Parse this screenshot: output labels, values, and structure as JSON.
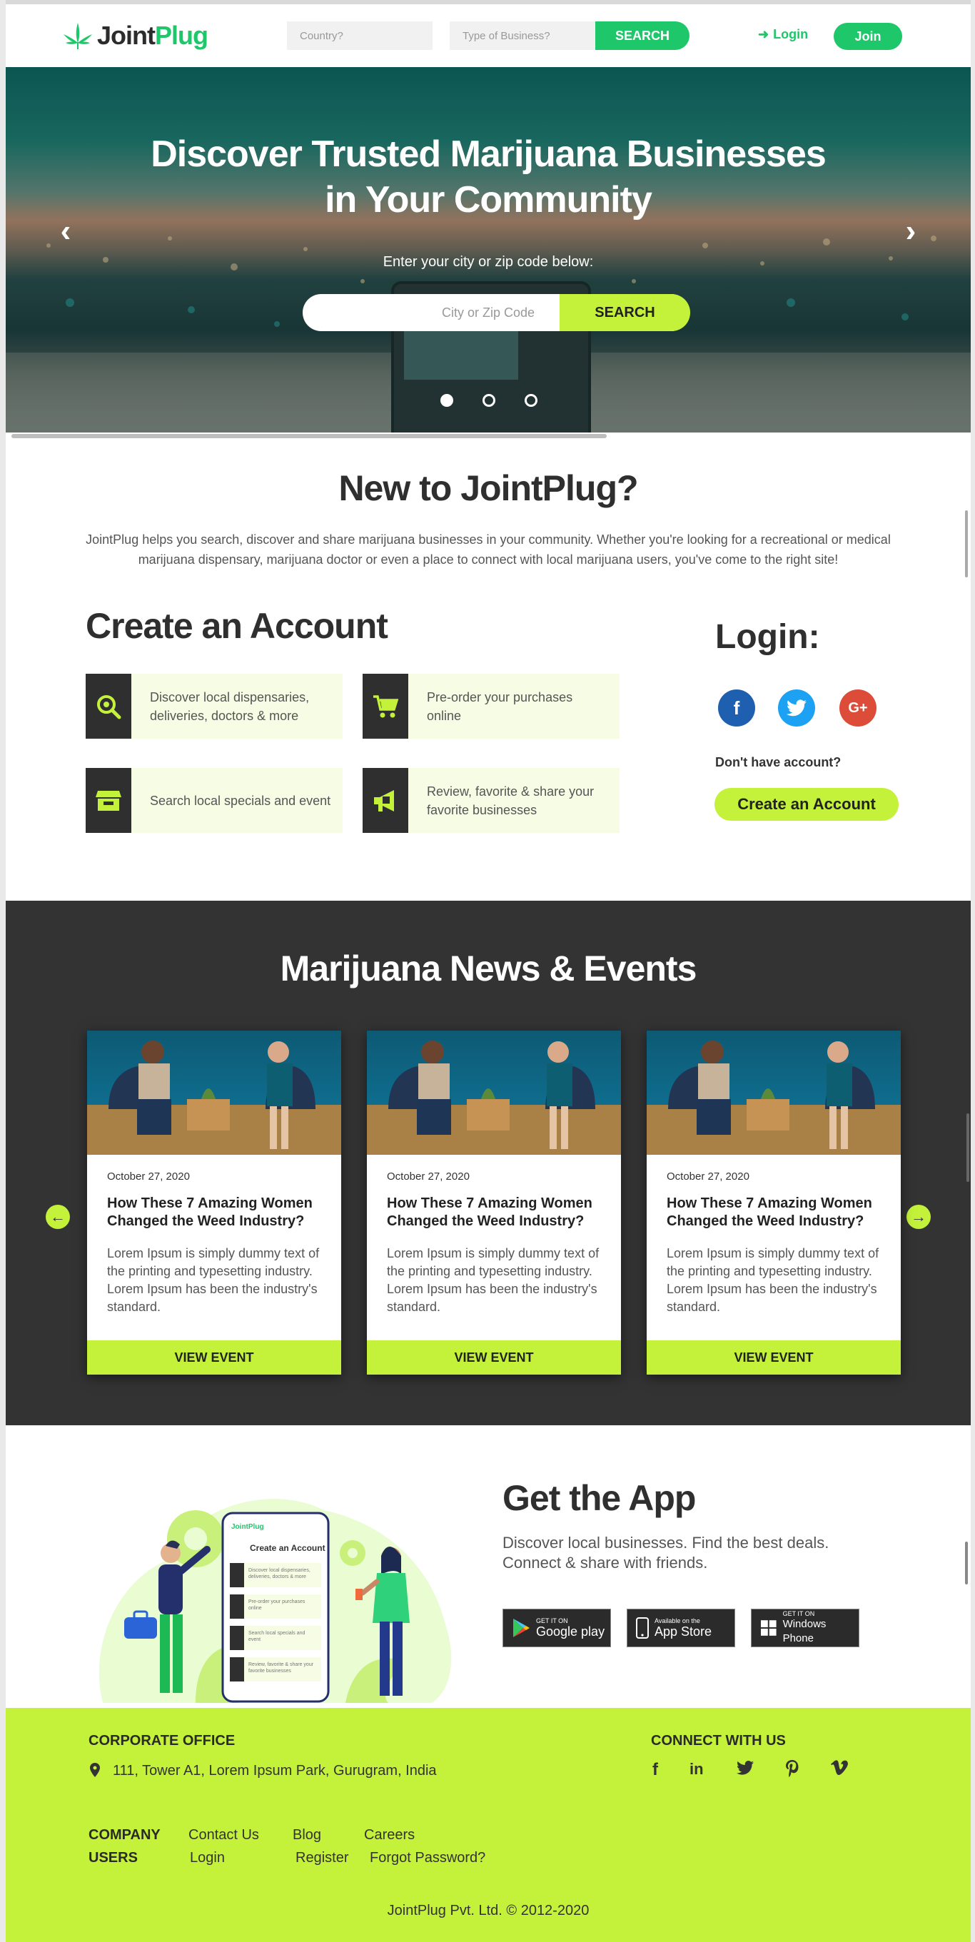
{
  "header": {
    "logo_j": "Joint",
    "logo_p": "Plug",
    "country_placeholder": "Country?",
    "business_placeholder": "Type of Business?",
    "search_label": "SEARCH",
    "login_label": "Login",
    "join_label": "Join"
  },
  "hero": {
    "title": "Discover Trusted Marijuana Businesses in Your Community",
    "subtitle": "Enter your city or zip code below:",
    "search_placeholder": "City or Zip Code",
    "search_label": "SEARCH",
    "slide_count": 3,
    "active_slide": 1
  },
  "intro": {
    "title": "New to JointPlug?",
    "text": "JointPlug helps you search, discover and share marijuana businesses in your community. Whether you're looking for a recreational or medical marijuana dispensary, marijuana doctor or even a place to connect with local marijuana users, you've come to the right site!"
  },
  "create_account": {
    "title": "Create an Account",
    "features": [
      {
        "icon": "search-leaf-icon",
        "text": "Discover local dispensaries, deliveries, doctors & more"
      },
      {
        "icon": "cart-icon",
        "text": "Pre-order your purchases online"
      },
      {
        "icon": "store-icon",
        "text": "Search local specials and event"
      },
      {
        "icon": "megaphone-icon",
        "text": "Review, favorite & share your favorite businesses"
      }
    ]
  },
  "login": {
    "title": "Login:",
    "no_account": "Don't have account?",
    "create_label": "Create an Account",
    "colors": {
      "facebook": "#1f5fb0",
      "twitter": "#1da1f2",
      "google": "#dd4b39"
    }
  },
  "news": {
    "title": "Marijuana News & Events",
    "cards": [
      {
        "date": "October 27, 2020",
        "title": "How These 7 Amazing Women Changed the Weed Industry?",
        "desc": "Lorem Ipsum is simply dummy text of the printing and typesetting industry. Lorem Ipsum has been the industry's standard.",
        "button": "VIEW EVENT"
      },
      {
        "date": "October 27, 2020",
        "title": "How These 7 Amazing Women Changed the Weed Industry?",
        "desc": "Lorem Ipsum is simply dummy text of the printing and typesetting industry. Lorem Ipsum has been the industry's standard.",
        "button": "VIEW EVENT"
      },
      {
        "date": "October 27, 2020",
        "title": "How These 7 Amazing Women Changed the Weed Industry?",
        "desc": "Lorem Ipsum is simply dummy text of the printing and typesetting industry. Lorem Ipsum has been the industry's standard.",
        "button": "VIEW EVENT"
      }
    ]
  },
  "app": {
    "title": "Get the App",
    "desc": "Discover local businesses. Find the best deals. Connect & share with friends.",
    "phone": {
      "logo": "JointPlug",
      "title": "Create an Account",
      "items": [
        "Discover local dispensaries, deliveries, doctors & more",
        "Pre-order your purchases online",
        "Search local specials and event",
        "Review, favorite & share your favorite businesses"
      ]
    },
    "stores": [
      {
        "small": "GET IT ON",
        "large": "Google play",
        "icon": "google-play-icon"
      },
      {
        "small": "Available on the",
        "large": "App Store",
        "icon": "apple-phone-icon"
      },
      {
        "small": "GET IT ON",
        "large": "Windows Phone",
        "icon": "windows-icon"
      }
    ]
  },
  "footer": {
    "office_title": "CORPORATE OFFICE",
    "address": "111, Tower A1, Lorem Ipsum Park, Gurugram, India",
    "connect_title": "CONNECT WITH US",
    "company_label": "COMPANY",
    "company_links": [
      "Contact Us",
      "Blog",
      "Careers"
    ],
    "users_label": "USERS",
    "user_links": [
      "Login",
      "Register",
      "Forgot Password?"
    ],
    "copyright": "JointPlug Pvt. Ltd. © 2012-2020"
  },
  "colors": {
    "brand_green": "#1ec76a",
    "lime": "#c4f23a",
    "dark": "#333333"
  }
}
